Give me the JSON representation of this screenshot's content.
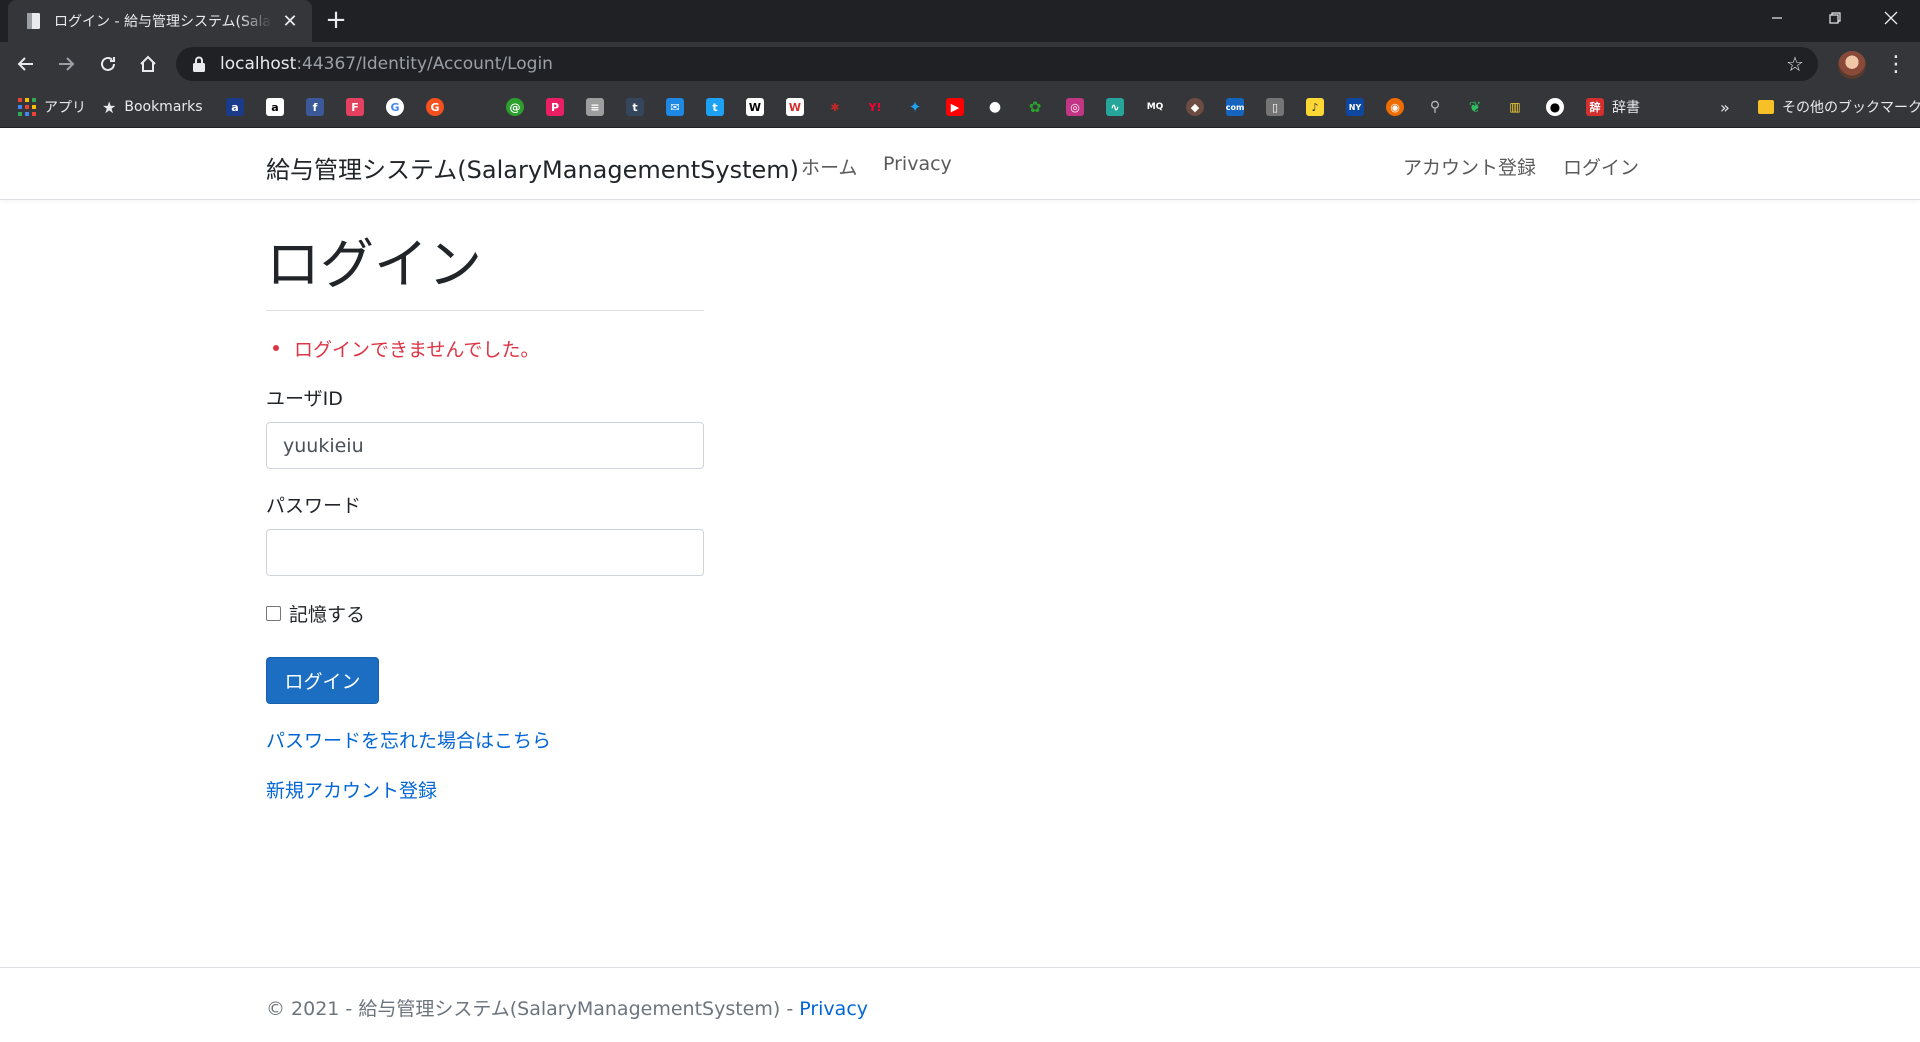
{
  "browser": {
    "tab_title": "ログイン - 給与管理システム(SalaryManagementSystem)",
    "url_host": "localhost",
    "url_rest": ":44367/Identity/Account/Login",
    "bookmarks": {
      "apps_label": "アプリ",
      "bookmarks_label": "Bookmarks",
      "jisho_label": "辞書",
      "overflow": "»",
      "other_label": "その他のブックマーク"
    }
  },
  "nav": {
    "brand": "給与管理システム(SalaryManagementSystem)",
    "home": "ホーム",
    "privacy": "Privacy",
    "register": "アカウント登録",
    "login": "ログイン"
  },
  "page": {
    "title": "ログイン",
    "error": "ログインできませんでした。",
    "userid_label": "ユーザID",
    "userid_value": "yuukieiu",
    "password_label": "パスワード",
    "remember_label": "記憶する",
    "login_button": "ログイン",
    "forgot_link": "パスワードを忘れた場合はこちら",
    "register_link": "新規アカウント登録"
  },
  "footer": {
    "text": "© 2021 - 給与管理システム(SalaryManagementSystem) - ",
    "privacy": "Privacy"
  },
  "colors": {
    "primary": "#1b6ec2",
    "link": "#0366d6",
    "error": "#dc3545"
  }
}
